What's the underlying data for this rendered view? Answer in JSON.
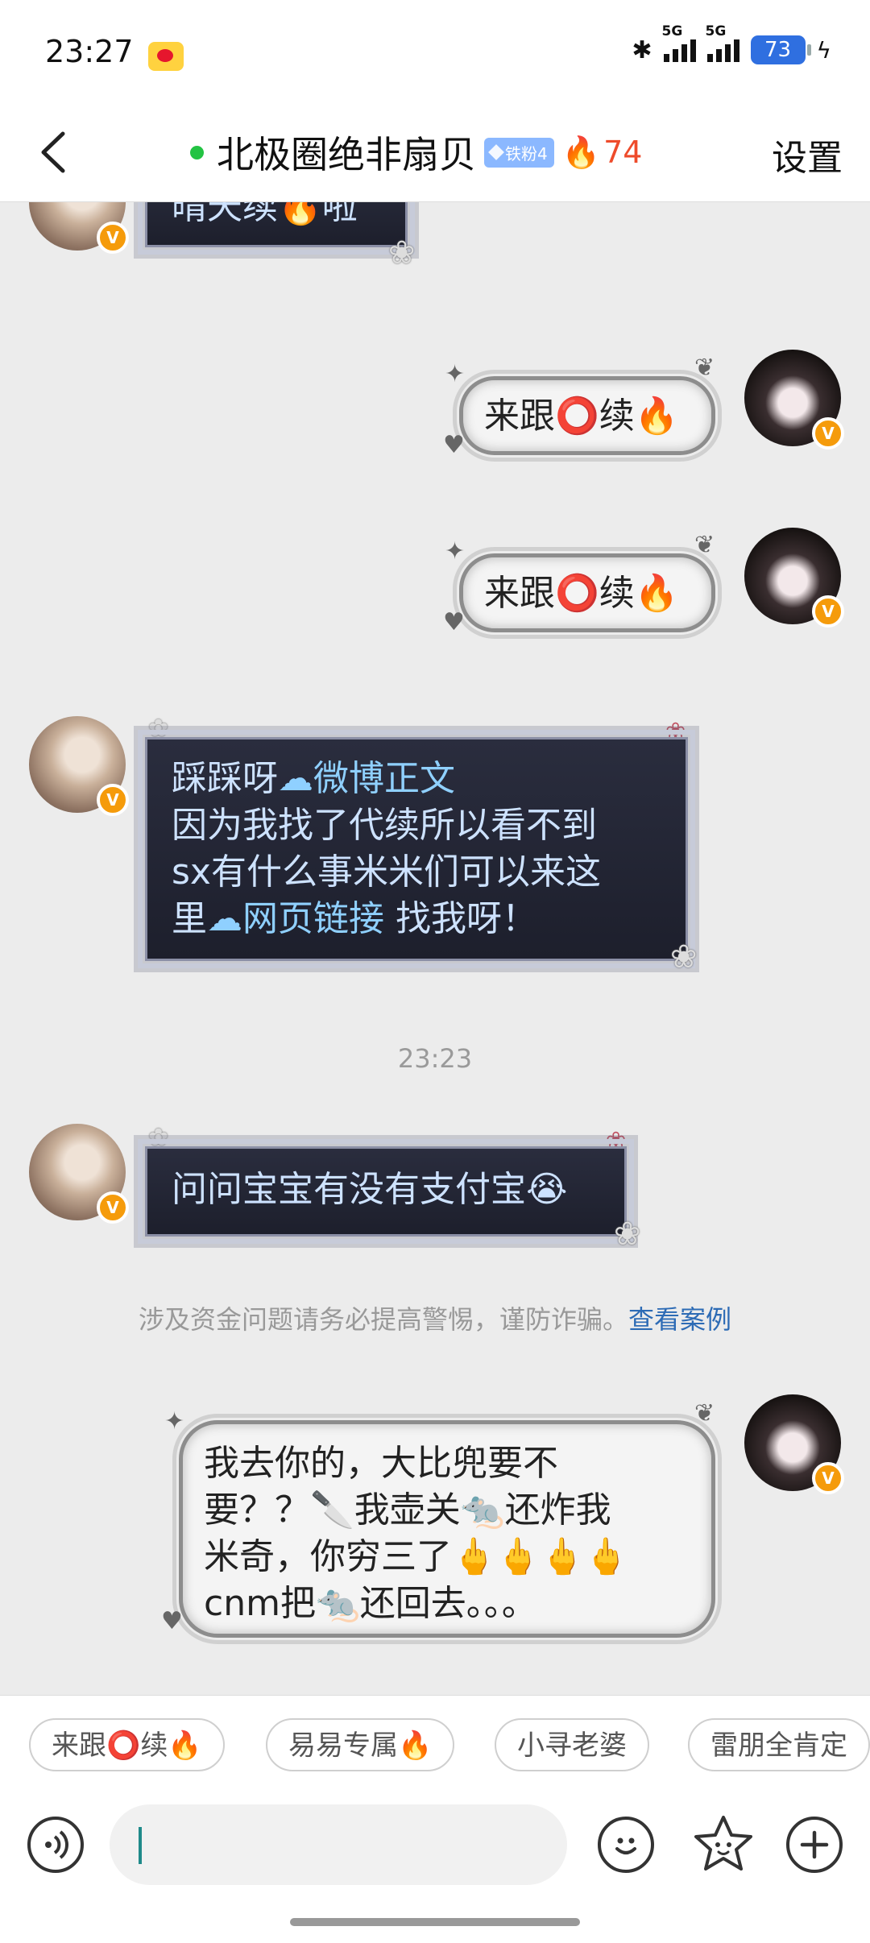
{
  "status_bar": {
    "time": "23:27",
    "signal1": "5G",
    "signal2": "5G",
    "battery": "73"
  },
  "header": {
    "title": "北极圈绝非扇贝",
    "fan_badge": "铁粉4",
    "fire_count": "74",
    "settings": "设置"
  },
  "messages": [
    {
      "side": "left",
      "style": "dark",
      "text": "晴天续🔥啦"
    },
    {
      "side": "right",
      "style": "light",
      "text": "来跟⭕续🔥"
    },
    {
      "side": "right",
      "style": "light",
      "text": "来跟⭕续🔥"
    },
    {
      "side": "left",
      "style": "dark",
      "line1_prefix": "踩踩呀",
      "line1_link": "微博正文",
      "line2": "因为我找了代续所以看不到",
      "line3": "sx有什么事米米们可以来这",
      "line4_prefix": "里",
      "line4_link": "网页链接",
      "line4_suffix": " 找我呀！"
    },
    {
      "side": "left",
      "style": "dark",
      "text": "问问宝宝有没有支付宝😭"
    },
    {
      "side": "right",
      "style": "light",
      "lines": [
        "我去你的，大比兜要不",
        "要？？🔪我壶关🐀还炸我",
        "米奇，你穷三了🖕🖕🖕🖕",
        "cnm把🐀还回去。。。"
      ]
    }
  ],
  "time_separator": "23:23",
  "warning": {
    "text": "涉及资金问题请务必提高警惕，谨防诈骗。",
    "link": "查看案例"
  },
  "quick_replies": [
    "来跟⭕续🔥",
    "易易专属🔥",
    "小寻老婆",
    "雷朋全肯定"
  ],
  "icons": {
    "back": "chevron-left-icon",
    "voice": "voice-icon",
    "emoji": "smile-icon",
    "sticker": "star-face-icon",
    "add": "plus-icon"
  },
  "colors": {
    "online": "#23c343",
    "fire": "#ee4b2b",
    "link": "#2d6bb5",
    "verified": "#f59b0b"
  }
}
